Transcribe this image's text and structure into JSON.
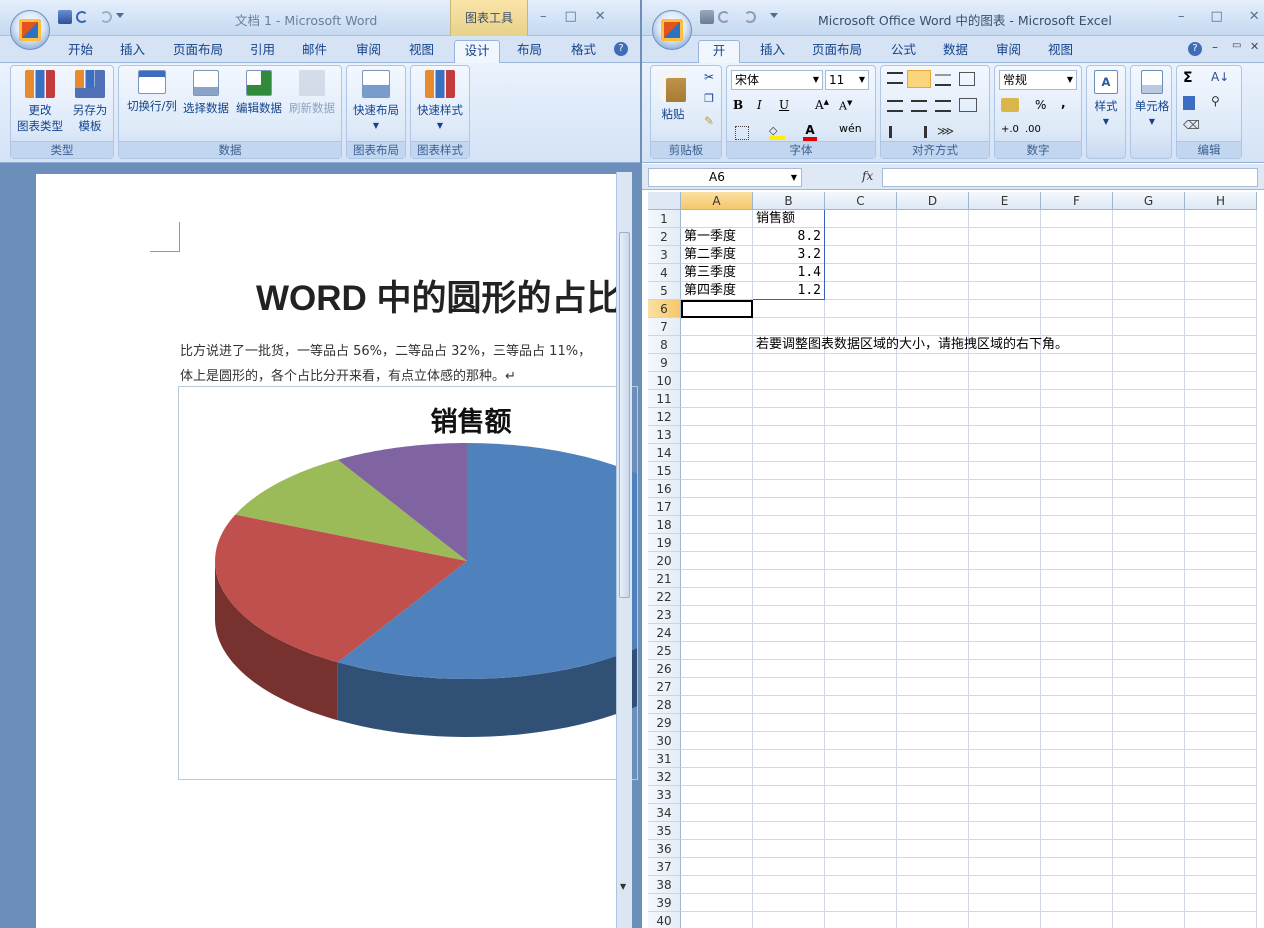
{
  "word": {
    "title": "文档 1 - Microsoft Word",
    "chart_tools_label": "图表工具",
    "tabs": [
      "开始",
      "插入",
      "页面布局",
      "引用",
      "邮件",
      "审阅",
      "视图",
      "设计",
      "布局",
      "格式"
    ],
    "active_tab": "设计",
    "groups": {
      "type": {
        "label": "类型",
        "change_chart_type": "更改\n图表类型",
        "save_as_template": "另存为\n模板"
      },
      "data": {
        "label": "数据",
        "switch_row_col": "切换行/列",
        "select_data": "选择数据",
        "edit_data": "编辑数据",
        "refresh_data": "刷新数据"
      },
      "layout": {
        "label": "图表布局",
        "quick_layout": "快速布局"
      },
      "styles": {
        "label": "图表样式",
        "quick_styles": "快速样式"
      }
    },
    "doc": {
      "heading": "WORD 中的圆形的占比",
      "body_line1": "比方说进了一批货，一等品占 56%，二等品占 32%，三等品占 11%，",
      "body_line2": "体上是圆形的，各个占比分开来看，有点立体感的那种。↵"
    },
    "chart_data": {
      "type": "pie",
      "title": "销售额",
      "categories": [
        "第一季度",
        "第二季度",
        "第三季度",
        "第四季度"
      ],
      "values": [
        8.2,
        3.2,
        1.4,
        1.2
      ],
      "colors": [
        "#4f81bd",
        "#c0504d",
        "#9bbb59",
        "#8064a2"
      ],
      "style": "3d-pie"
    }
  },
  "excel": {
    "title": "Microsoft Office Word 中的图表 - Microsoft Excel",
    "tabs": [
      "开始",
      "插入",
      "页面布局",
      "公式",
      "数据",
      "审阅",
      "视图"
    ],
    "active_tab": "开始",
    "groups": {
      "clipboard": {
        "label": "剪贴板",
        "paste": "粘贴"
      },
      "font": {
        "label": "字体",
        "font_name": "宋体",
        "font_size": "11"
      },
      "alignment": {
        "label": "对齐方式"
      },
      "number": {
        "label": "数字",
        "format": "常规"
      },
      "styles": {
        "label": "样式"
      },
      "cells": {
        "label": "单元格"
      },
      "editing": {
        "label": "编辑"
      }
    },
    "name_box": "A6",
    "fx": "fx",
    "columns": [
      "A",
      "B",
      "C",
      "D",
      "E",
      "F",
      "G",
      "H"
    ],
    "rows": [
      "1",
      "2",
      "3",
      "4",
      "5",
      "6",
      "7",
      "8",
      "9",
      "10",
      "11",
      "12",
      "13",
      "14",
      "15",
      "16",
      "17",
      "18",
      "19",
      "20",
      "21",
      "22",
      "23",
      "24",
      "25",
      "26",
      "27",
      "28",
      "29",
      "30",
      "31",
      "32",
      "33",
      "34",
      "35",
      "36",
      "37",
      "38",
      "39",
      "40"
    ],
    "cells": {
      "B1": "销售额",
      "A2": "第一季度",
      "B2": "8.2",
      "A3": "第二季度",
      "B3": "3.2",
      "A4": "第三季度",
      "B4": "1.4",
      "A5": "第四季度",
      "B5": "1.2",
      "B8": "若要调整图表数据区域的大小，请拖拽区域的右下角。"
    }
  }
}
